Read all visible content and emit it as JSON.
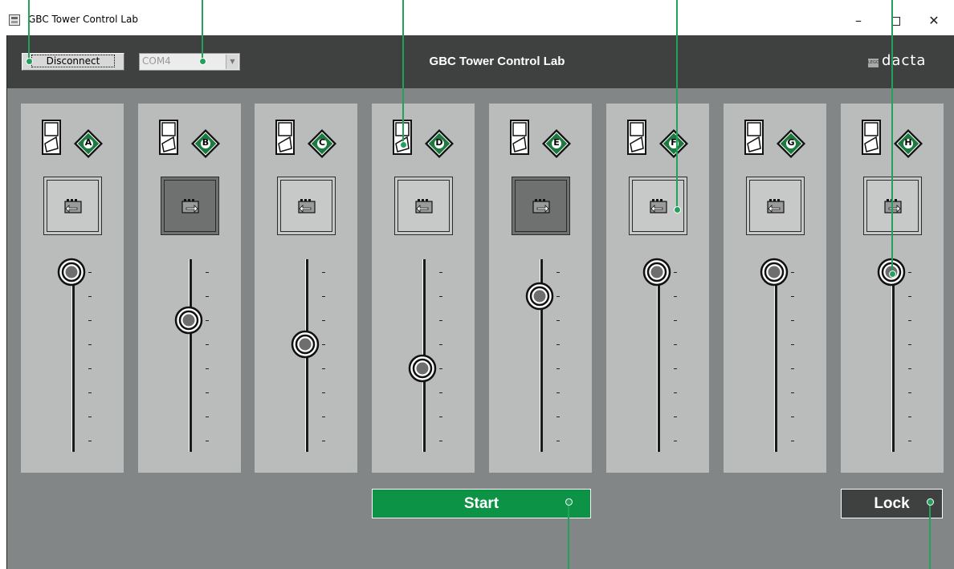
{
  "window": {
    "title": "GBC Tower Control Lab",
    "minimize": "–",
    "close": "✕"
  },
  "header": {
    "disconnect_label": "Disconnect",
    "port_value": "COM4",
    "title": "GBC Tower Control Lab",
    "logo_small": "LEGO",
    "logo_text": "dacta"
  },
  "channels": [
    {
      "port": "A",
      "motor_active": false,
      "direction": "left",
      "level": 1
    },
    {
      "port": "B",
      "motor_active": true,
      "direction": "right",
      "level": 0.6
    },
    {
      "port": "C",
      "motor_active": false,
      "direction": "left",
      "level": 0.4
    },
    {
      "port": "D",
      "motor_active": false,
      "direction": "left",
      "level": 0.2
    },
    {
      "port": "E",
      "motor_active": true,
      "direction": "right",
      "level": 0.8
    },
    {
      "port": "F",
      "motor_active": false,
      "direction": "left",
      "level": 1
    },
    {
      "port": "G",
      "motor_active": false,
      "direction": "left",
      "level": 1
    },
    {
      "port": "H",
      "motor_active": false,
      "direction": "right",
      "level": 1
    }
  ],
  "controls": {
    "start_label": "Start",
    "lock_label": "Lock"
  },
  "colors": {
    "header_bg": "#3f4140",
    "panel_bg": "#838686",
    "channel_bg": "#babcbc",
    "start_green": "#0d9345",
    "annotation_green": "#22a05c"
  }
}
